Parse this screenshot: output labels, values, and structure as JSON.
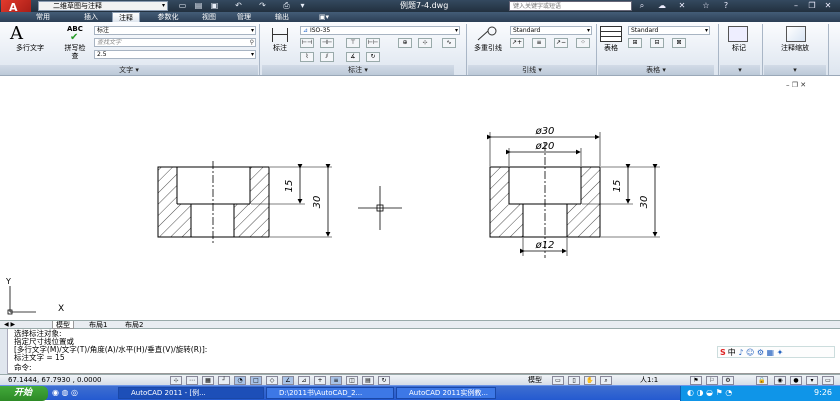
{
  "titlebar": {
    "workspace": "二维草图与注释",
    "document_title": "例题7-4.dwg",
    "search_placeholder": "键入关键字或短语",
    "quick_access_icons": [
      "new-icon",
      "open-icon",
      "save-icon",
      "undo-icon",
      "redo-icon",
      "plot-icon"
    ]
  },
  "tabs": [
    "常用",
    "插入",
    "注释",
    "参数化",
    "视图",
    "管理",
    "输出"
  ],
  "active_tab": "注释",
  "ribbon": {
    "text_panel": {
      "mtext_label": "多行文字",
      "spell_label": "拼写检查",
      "style_value": "标注",
      "find_placeholder": "查找文字",
      "height_value": "2.5",
      "footer": "文字"
    },
    "dim_panel": {
      "dim_label": "标注",
      "style_value": "ISO-35",
      "footer": "标注"
    },
    "leader_panel": {
      "multileader_label": "多重引线",
      "style_value": "Standard",
      "footer": "引线"
    },
    "table_panel": {
      "table_label": "表格",
      "style_value": "Standard",
      "footer": "表格"
    },
    "markup_label": "标记",
    "scale_label": "注释缩放"
  },
  "drawing": {
    "left_view_dims": [
      "15",
      "30"
    ],
    "right_view_dims": [
      "ø30",
      "ø20",
      "15",
      "30",
      "ø12"
    ],
    "ucs_x": "X",
    "ucs_y": "Y"
  },
  "layout_tabs": [
    "模型",
    "布局1",
    "布局2"
  ],
  "command_lines": [
    "选择标注对象:",
    "指定尺寸线位置或",
    "[多行文字(M)/文字(T)/角度(A)/水平(H)/垂直(V)/旋转(R)]:",
    "标注文字 = 15",
    "命令:"
  ],
  "ime_label": "中",
  "status": {
    "coords": "67.1444, 67.7930 , 0.0000",
    "model_label": "模型",
    "scale": "人1:1"
  },
  "taskbar": {
    "start": "开始",
    "tasks": [
      "AutoCAD 2011 - [例...",
      "D:\\2011书\\AutoCAD_2...",
      "AutoCAD 2011实例教..."
    ],
    "clock": "9:26"
  },
  "colors": {
    "accent": "#2c3f55",
    "logo": "#d8312a",
    "taskbar": "#245ad0"
  }
}
